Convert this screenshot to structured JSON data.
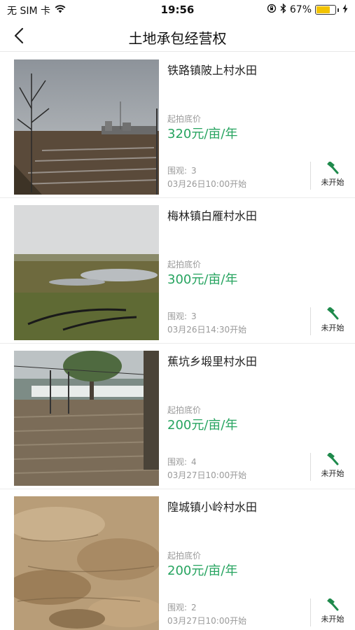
{
  "status_bar": {
    "carrier": "无 SIM 卡",
    "time": "19:56",
    "battery_percent": "67%",
    "battery_level": 0.67,
    "icons": [
      "wifi-icon",
      "orientation-lock-icon",
      "bluetooth-icon",
      "battery-icon",
      "charging-icon"
    ]
  },
  "nav": {
    "title": "土地承包经营权",
    "back_icon": "chevron-left-icon"
  },
  "colors": {
    "accent_green": "#27a460",
    "icon_green": "#1f8a4c",
    "muted_text": "#9a9a9a"
  },
  "listings": [
    {
      "title": "铁路镇陂上村水田",
      "price_label": "起拍底价",
      "price": "320元/亩/年",
      "views_label": "围观:",
      "views": "3",
      "start_time": "03月26日10:00开始",
      "status": "未开始"
    },
    {
      "title": "梅林镇白雁村水田",
      "price_label": "起拍底价",
      "price": "300元/亩/年",
      "views_label": "围观:",
      "views": "3",
      "start_time": "03月26日14:30开始",
      "status": "未开始"
    },
    {
      "title": "蕉坑乡塅里村水田",
      "price_label": "起拍底价",
      "price": "200元/亩/年",
      "views_label": "围观:",
      "views": "4",
      "start_time": "03月27日10:00开始",
      "status": "未开始"
    },
    {
      "title": "隍城镇小岭村水田",
      "price_label": "起拍底价",
      "price": "200元/亩/年",
      "views_label": "围观:",
      "views": "2",
      "start_time": "03月27日10:00开始",
      "status": "未开始"
    }
  ]
}
